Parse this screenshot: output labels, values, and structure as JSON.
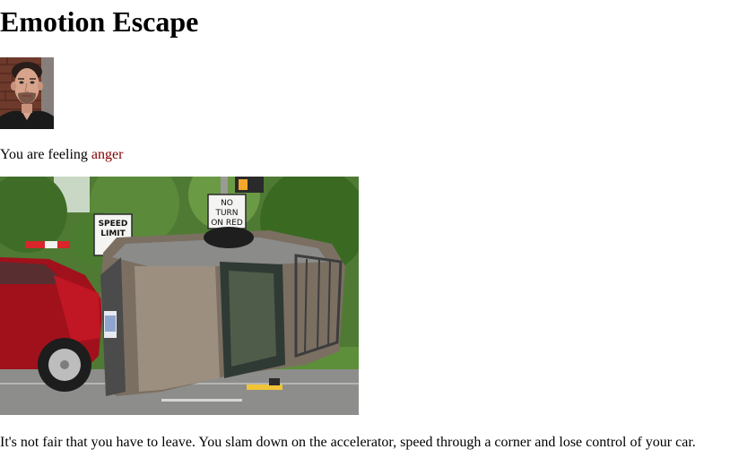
{
  "page": {
    "title": "Emotion Escape"
  },
  "profile": {
    "photo_icon": "face-photo"
  },
  "feeling": {
    "prefix": "You are feeling ",
    "emotion": "anger",
    "emotion_color": "#800000"
  },
  "scene": {
    "image_icon": "car-crash-photo",
    "signs": {
      "speed_limit_line1": "SPEED",
      "speed_limit_line2": "LIMIT",
      "no_turn_line1": "NO",
      "no_turn_line2": "TURN",
      "no_turn_line3": "ON RED"
    }
  },
  "story": {
    "text": "It's not fair that you have to leave. You slam down on the accelerator, speed through a corner and lose control of your car."
  }
}
